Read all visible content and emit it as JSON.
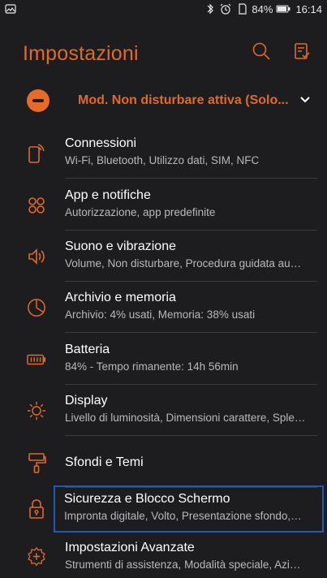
{
  "status": {
    "time": "16:14",
    "battery": "84%"
  },
  "header": {
    "title": "Impostazioni"
  },
  "dnd": {
    "label": "Mod. Non disturbare attiva (Solo..."
  },
  "items": [
    {
      "title": "Connessioni",
      "subtitle": "Wi-Fi, Bluetooth, Utilizzo dati, SIM, NFC",
      "icon": "connections-icon"
    },
    {
      "title": "App e notifiche",
      "subtitle": "Autorizzazione, app predefinite",
      "icon": "apps-icon"
    },
    {
      "title": "Suono e vibrazione",
      "subtitle": "Volume, Non disturbare, Procedura guidata au…",
      "icon": "sound-icon"
    },
    {
      "title": "Archivio e memoria",
      "subtitle": "Archivio: 4% usati, Memoria: 38% usati",
      "icon": "storage-icon"
    },
    {
      "title": "Batteria",
      "subtitle": "84% - Tempo rimanente: 14h 56min",
      "icon": "battery-icon"
    },
    {
      "title": "Display",
      "subtitle": "Livello di luminosità, Dimensioni carattere, Sple…",
      "icon": "display-icon"
    },
    {
      "title": "Sfondi e Temi",
      "subtitle": "",
      "icon": "theme-icon"
    },
    {
      "title": "Sicurezza e Blocco Schermo",
      "subtitle": "Impronta digitale, Volto, Presentazione sfondo,…",
      "icon": "lock-icon"
    },
    {
      "title": "Impostazioni Avanzate",
      "subtitle": "Strumenti di assistenza, Modalità speciale, Azi…",
      "icon": "advanced-icon"
    }
  ]
}
